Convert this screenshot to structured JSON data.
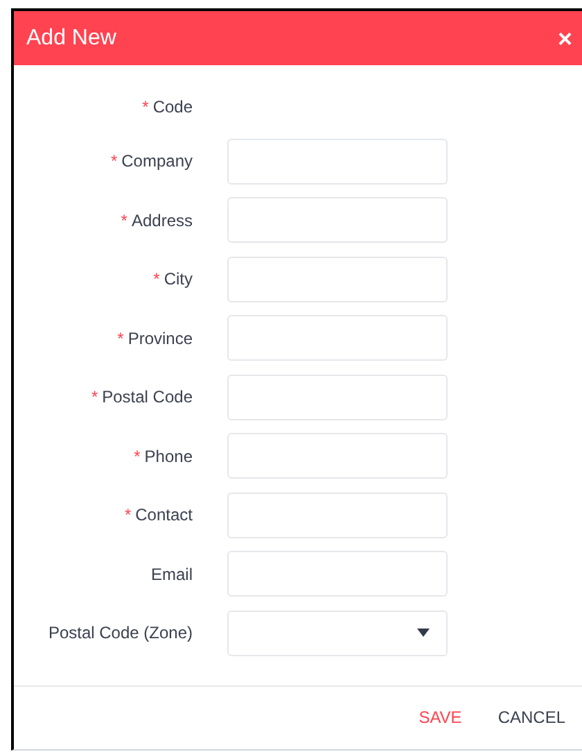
{
  "dialog": {
    "title": "Add New",
    "close": "×"
  },
  "fields": [
    {
      "kind": "static",
      "required_mark": "*",
      "label": "Code"
    },
    {
      "kind": "input",
      "required_mark": "*",
      "label": "Company"
    },
    {
      "kind": "input",
      "required_mark": "*",
      "label": "Address"
    },
    {
      "kind": "input",
      "required_mark": "*",
      "label": "City"
    },
    {
      "kind": "input",
      "required_mark": "*",
      "label": "Province"
    },
    {
      "kind": "input",
      "required_mark": "*",
      "label": "Postal Code"
    },
    {
      "kind": "input",
      "required_mark": "*",
      "label": "Phone"
    },
    {
      "kind": "input",
      "required_mark": "*",
      "label": "Contact"
    },
    {
      "kind": "input",
      "label": "Email"
    },
    {
      "kind": "select",
      "label": "Postal Code (Zone)"
    }
  ],
  "buttons": [
    {
      "kind": "primary",
      "label": "SAVE"
    },
    {
      "kind": "secondary",
      "label": "CANCEL"
    }
  ]
}
